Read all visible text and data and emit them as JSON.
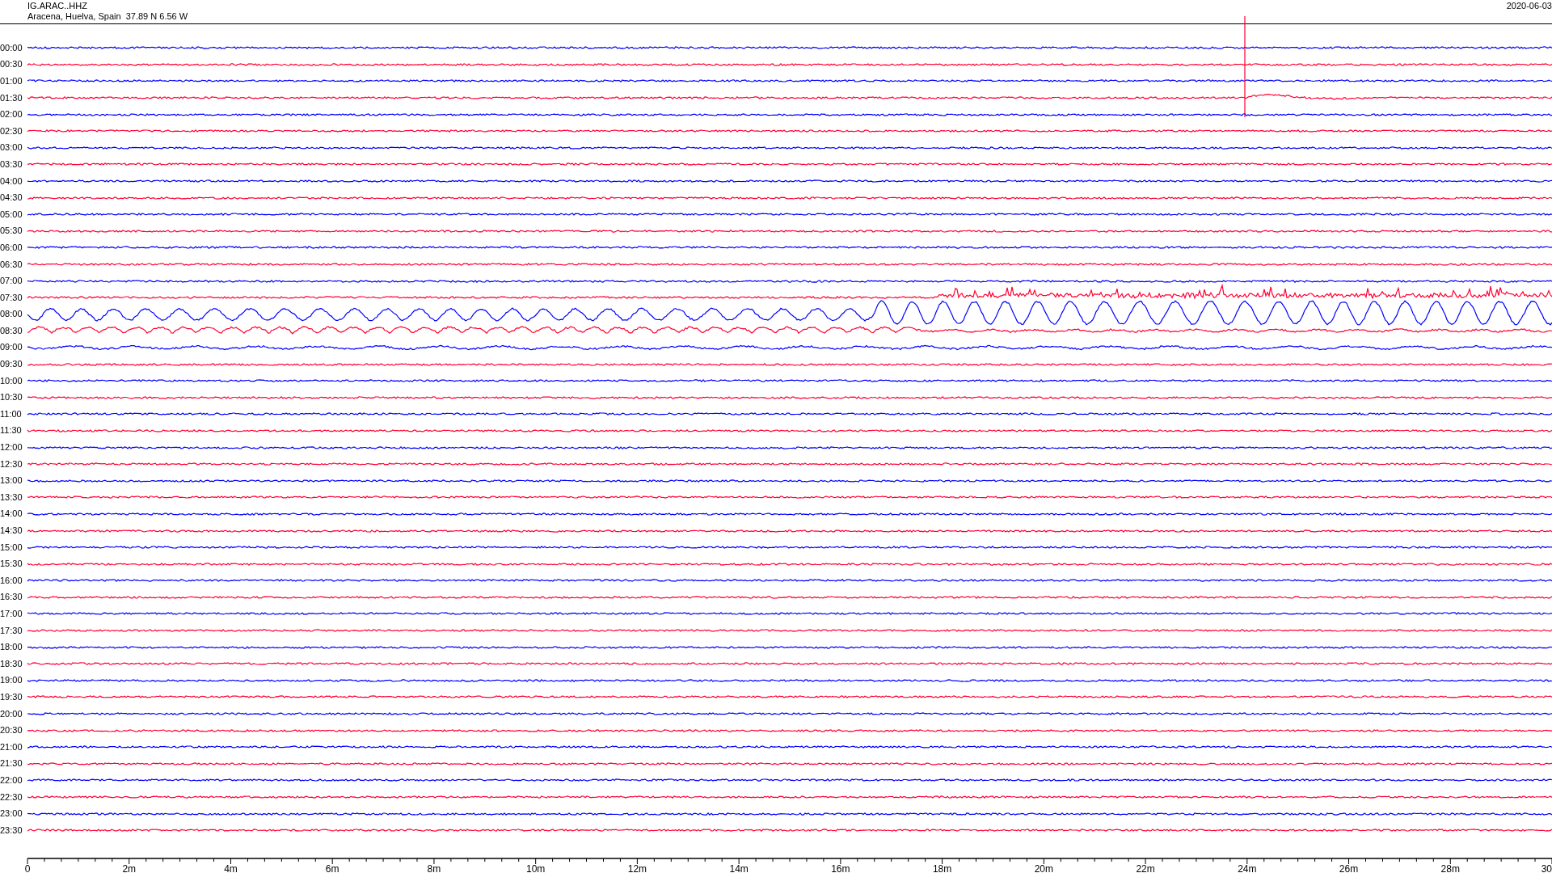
{
  "header": {
    "station": "IG.ARAC..HHZ",
    "location": "Aracena, Huelva, Spain  37.89 N 6.56 W",
    "date": "2020-06-03"
  },
  "rows": [
    {
      "time": "00:00",
      "color": "#0000ff"
    },
    {
      "time": "00:30",
      "color": "#ff0033"
    },
    {
      "time": "01:00",
      "color": "#0000ff"
    },
    {
      "time": "01:30",
      "color": "#ff0033"
    },
    {
      "time": "02:00",
      "color": "#0000ff"
    },
    {
      "time": "02:30",
      "color": "#ff0033"
    },
    {
      "time": "03:00",
      "color": "#0000ff"
    },
    {
      "time": "03:30",
      "color": "#ff0033"
    },
    {
      "time": "04:00",
      "color": "#0000ff"
    },
    {
      "time": "04:30",
      "color": "#ff0033"
    },
    {
      "time": "05:00",
      "color": "#0000ff"
    },
    {
      "time": "05:30",
      "color": "#ff0033"
    },
    {
      "time": "06:00",
      "color": "#0000ff"
    },
    {
      "time": "06:30",
      "color": "#ff0033"
    },
    {
      "time": "07:00",
      "color": "#0000ff"
    },
    {
      "time": "07:30",
      "color": "#ff0033"
    },
    {
      "time": "08:00",
      "color": "#0000ff"
    },
    {
      "time": "08:30",
      "color": "#ff0033"
    },
    {
      "time": "09:00",
      "color": "#0000ff"
    },
    {
      "time": "09:30",
      "color": "#ff0033"
    },
    {
      "time": "10:00",
      "color": "#0000ff"
    },
    {
      "time": "10:30",
      "color": "#ff0033"
    },
    {
      "time": "11:00",
      "color": "#0000ff"
    },
    {
      "time": "11:30",
      "color": "#ff0033"
    },
    {
      "time": "12:00",
      "color": "#0000ff"
    },
    {
      "time": "12:30",
      "color": "#ff0033"
    },
    {
      "time": "13:00",
      "color": "#0000ff"
    },
    {
      "time": "13:30",
      "color": "#ff0033"
    },
    {
      "time": "14:00",
      "color": "#0000ff"
    },
    {
      "time": "14:30",
      "color": "#ff0033"
    },
    {
      "time": "15:00",
      "color": "#0000ff"
    },
    {
      "time": "15:30",
      "color": "#ff0033"
    },
    {
      "time": "16:00",
      "color": "#0000ff"
    },
    {
      "time": "16:30",
      "color": "#ff0033"
    },
    {
      "time": "17:00",
      "color": "#0000ff"
    },
    {
      "time": "17:30",
      "color": "#ff0033"
    },
    {
      "time": "18:00",
      "color": "#0000ff"
    },
    {
      "time": "18:30",
      "color": "#ff0033"
    },
    {
      "time": "19:00",
      "color": "#0000ff"
    },
    {
      "time": "19:30",
      "color": "#ff0033"
    },
    {
      "time": "20:00",
      "color": "#0000ff"
    },
    {
      "time": "20:30",
      "color": "#ff0033"
    },
    {
      "time": "21:00",
      "color": "#0000ff"
    },
    {
      "time": "21:30",
      "color": "#ff0033"
    },
    {
      "time": "22:00",
      "color": "#0000ff"
    },
    {
      "time": "22:30",
      "color": "#ff0033"
    },
    {
      "time": "23:00",
      "color": "#0000ff"
    },
    {
      "time": "23:30",
      "color": "#ff0033"
    }
  ],
  "x_axis": {
    "ticks": [
      "0",
      "2m",
      "4m",
      "6m",
      "8m",
      "10m",
      "12m",
      "14m",
      "16m",
      "18m",
      "20m",
      "22m",
      "24m",
      "26m",
      "28m",
      "30"
    ]
  }
}
